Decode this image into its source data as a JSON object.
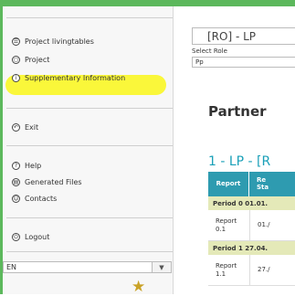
{
  "sidebar": {
    "items": [
      {
        "label": "Project livingtables",
        "icon": "list-icon",
        "glyph": "☰"
      },
      {
        "label": "Project",
        "icon": "project-icon",
        "glyph": "◻"
      },
      {
        "label": "Supplementary Information",
        "icon": "info-icon",
        "glyph": "i"
      },
      {
        "label": "Exit",
        "icon": "back-arrow-icon",
        "glyph": "↶"
      },
      {
        "label": "Help",
        "icon": "help-icon",
        "glyph": "?"
      },
      {
        "label": "Generated Files",
        "icon": "files-icon",
        "glyph": "▤"
      },
      {
        "label": "Contacts",
        "icon": "contacts-icon",
        "glyph": "☺"
      },
      {
        "label": "Logout",
        "icon": "power-icon",
        "glyph": "⏻"
      }
    ],
    "language": "EN",
    "highlight_color": "#faf73a"
  },
  "header": {
    "role_title": "[RO] - LP",
    "select_role_label": "Select Role",
    "role_value": "Pp"
  },
  "main": {
    "heading": "Partner",
    "table_title": "1 - LP - [R",
    "columns": [
      "Report",
      "Re\nSta"
    ],
    "rows": [
      {
        "type": "period",
        "label": "Period 0 01.01."
      },
      {
        "type": "report",
        "report": "Report\n0.1",
        "date": "01./"
      },
      {
        "type": "period",
        "label": "Period 1 27.04."
      },
      {
        "type": "report",
        "report": "Report\n1.1",
        "date": "27./"
      }
    ]
  },
  "colors": {
    "accent_green": "#5cb85c",
    "table_header": "#2e9bb0",
    "period_row": "#e4e9b8",
    "table_title": "#1aa0b8"
  }
}
